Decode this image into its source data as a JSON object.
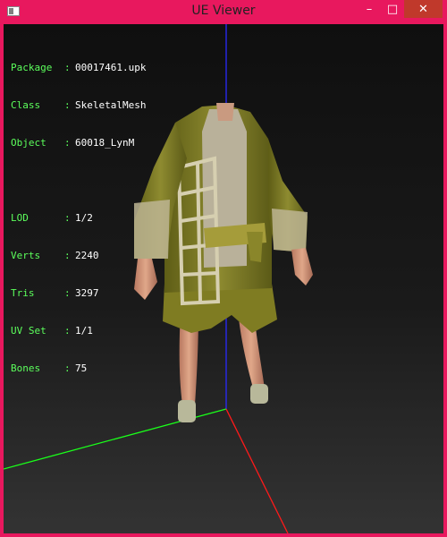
{
  "window": {
    "title": "UE Viewer",
    "minimize_glyph": "–",
    "maximize_glyph": "□",
    "close_glyph": "✕"
  },
  "info": {
    "package_label": "Package",
    "package": "00017461.upk",
    "class_label": "Class",
    "class": "SkeletalMesh",
    "object_label": "Object",
    "object": "60018_LynM",
    "lod_label": "LOD",
    "lod": "1/2",
    "verts_label": "Verts",
    "verts": "2240",
    "tris_label": "Tris",
    "tris": "3297",
    "uvset_label": "UV Set",
    "uvset": "1/1",
    "bones_label": "Bones",
    "bones": "75",
    "separator": ":"
  },
  "colors": {
    "frame": "#e8185e",
    "hud_label": "#5cff5c",
    "hud_value": "#ffffff",
    "axis_x": "#ff1a1a",
    "axis_y": "#1aff1a",
    "axis_z": "#2a2aff"
  }
}
